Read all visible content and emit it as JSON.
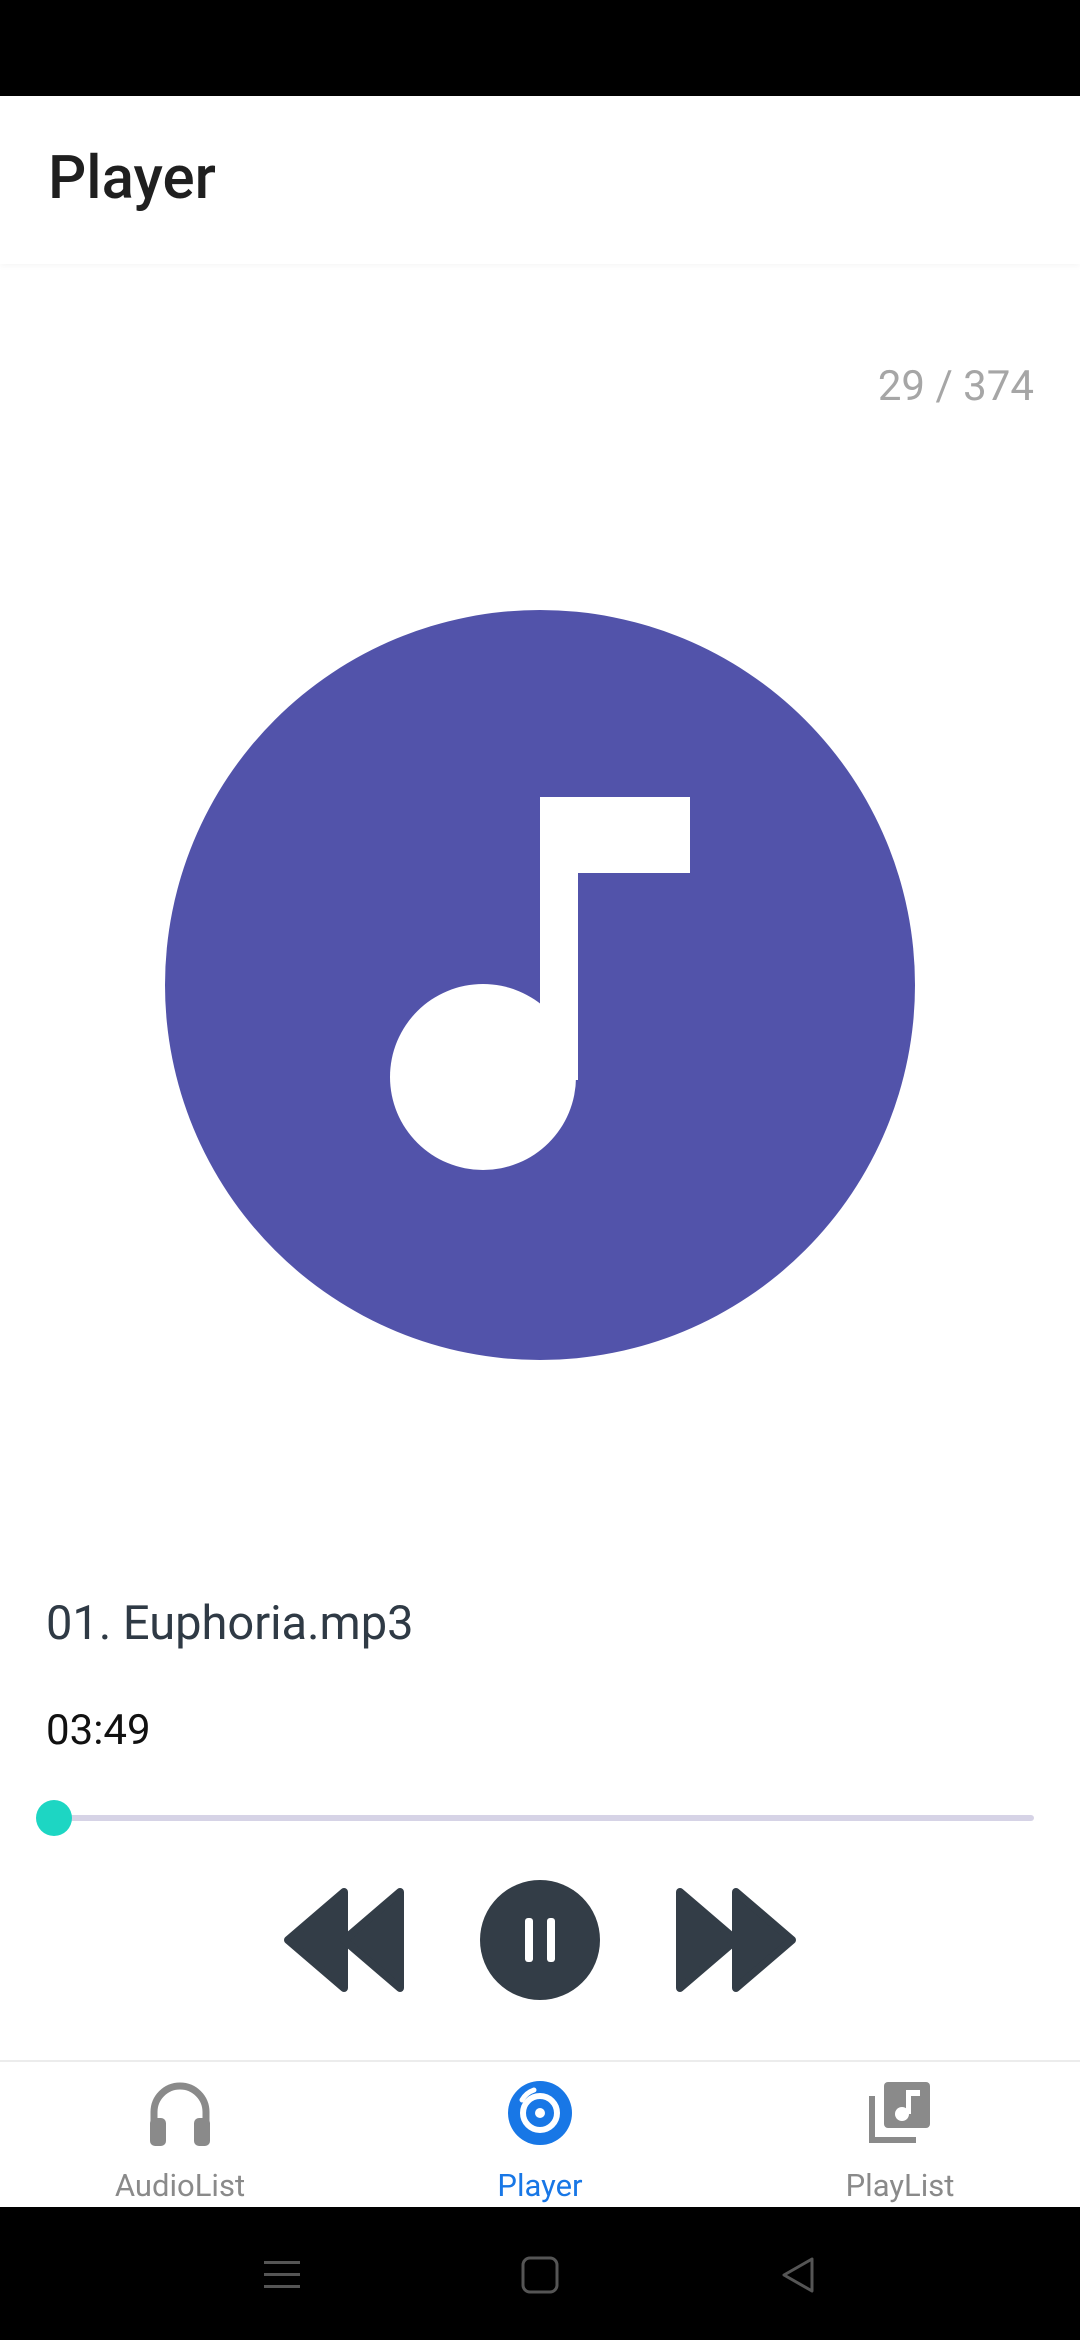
{
  "app_bar": {
    "title": "Player"
  },
  "player": {
    "counter": "29 / 374",
    "track_title": "01. Euphoria.mp3",
    "elapsed_time": "03:49",
    "progress": 0.0,
    "album_art_icon": "music-note-icon",
    "controls": {
      "rewind_icon": "rewind-icon",
      "pause_icon": "pause-icon",
      "fast_forward_icon": "fast-forward-icon"
    }
  },
  "bottom_nav": {
    "items": [
      {
        "label": "AudioList",
        "icon": "headphones-icon",
        "active": false
      },
      {
        "label": "Player",
        "icon": "disc-icon",
        "active": true
      },
      {
        "label": "PlayList",
        "icon": "playlist-icon",
        "active": false
      }
    ]
  },
  "system_nav": {
    "menu_icon": "menu-icon",
    "home_icon": "home-icon",
    "back_icon": "back-icon"
  },
  "colors": {
    "accent": "#1877e6",
    "album_bg": "#5253AA",
    "seek_thumb": "#1dd6c3",
    "controls": "#333d47"
  }
}
